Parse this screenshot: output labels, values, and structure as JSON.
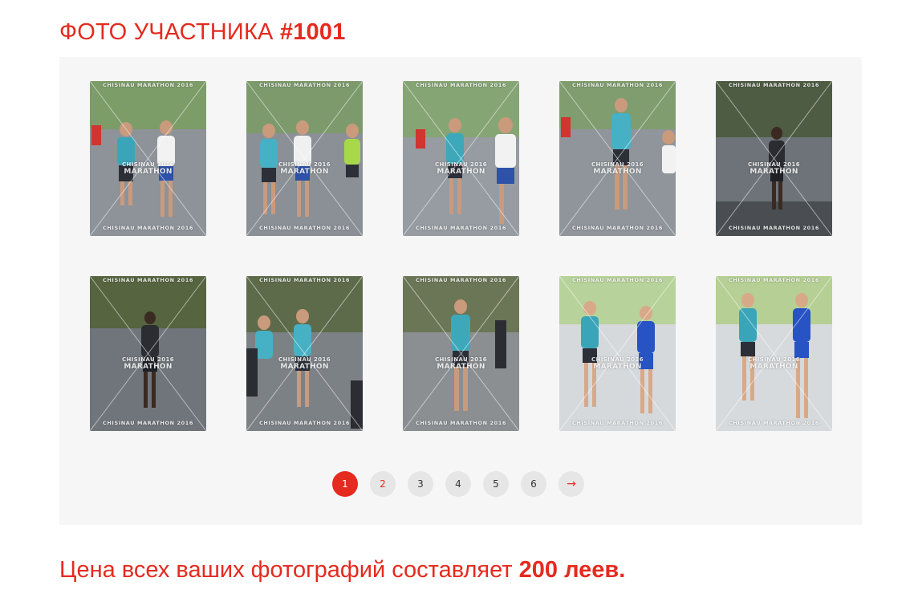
{
  "header": {
    "title_prefix": "ФОТО УЧАСТНИКА ",
    "bib_number": "#1001"
  },
  "gallery": {
    "watermark_event": "CHISINAU MARATHON 2016",
    "watermark_top": "CHISINAU MARATHON 2016",
    "watermark_center_1": "CHISINAU 2016",
    "watermark_center_2": "MARATHON"
  },
  "photos": [
    {
      "id": "photo-1"
    },
    {
      "id": "photo-2"
    },
    {
      "id": "photo-3"
    },
    {
      "id": "photo-4"
    },
    {
      "id": "photo-5"
    },
    {
      "id": "photo-6"
    },
    {
      "id": "photo-7"
    },
    {
      "id": "photo-8"
    },
    {
      "id": "photo-9"
    },
    {
      "id": "photo-10"
    }
  ],
  "pagination": {
    "pages": [
      "1",
      "2",
      "3",
      "4",
      "5",
      "6"
    ],
    "current": "1",
    "next_label": "→"
  },
  "price": {
    "prefix": "Цена всех ваших фотографий составляет ",
    "amount": "200 леев."
  },
  "colors": {
    "accent": "#e52a1f",
    "panel_bg": "#f6f6f6",
    "page_btn_bg": "#e6e6e6"
  }
}
